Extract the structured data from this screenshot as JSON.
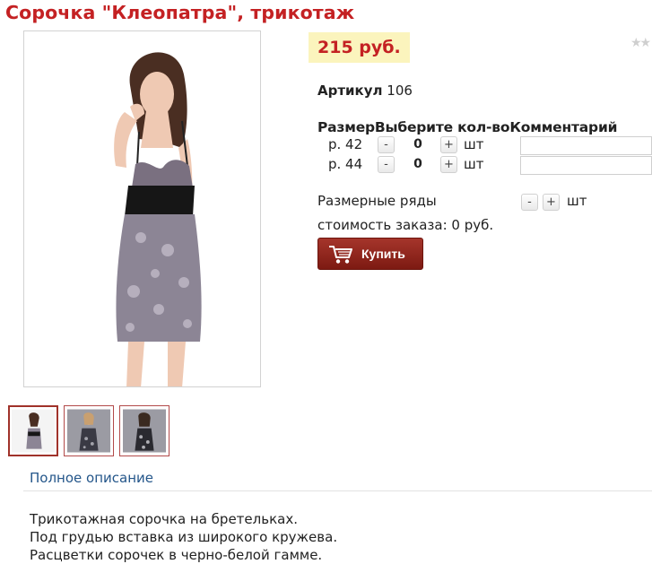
{
  "product": {
    "title": "Сорочка \"Клеопатра\", трикотаж",
    "price": "215 руб.",
    "rating_stars": "★★",
    "sku_label": "Артикул",
    "sku_value": "106"
  },
  "order_table": {
    "header": "РазмерВыберите кол-воКомментарий",
    "rows": [
      {
        "size": "р. 42",
        "minus": "-",
        "qty": "0",
        "plus": "+",
        "unit": "шт",
        "comment": ""
      },
      {
        "size": "р. 44",
        "minus": "-",
        "qty": "0",
        "plus": "+",
        "unit": "шт",
        "comment": ""
      }
    ]
  },
  "size_series": {
    "label": "Размерные ряды",
    "minus": "-",
    "plus": "+",
    "unit": "шт"
  },
  "order_total": "стоимость заказа: 0 руб.",
  "buy_button": {
    "label": "Купить",
    "icon": "cart-icon"
  },
  "gallery": {
    "thumbnail_count": 3,
    "active_index": 0
  },
  "description": {
    "tab_label": "Полное описание",
    "lines": [
      "Трикотажная сорочка на бретельках.",
      "Под грудью вставка из широкого кружева.",
      "Расцветки сорочек в черно-белой гамме."
    ]
  },
  "colors": {
    "title": "#c42123",
    "price_bg": "#fbf4bd",
    "buy_button": "#8e261c",
    "link": "#24568a",
    "thumb_border": "#b24a4a"
  }
}
